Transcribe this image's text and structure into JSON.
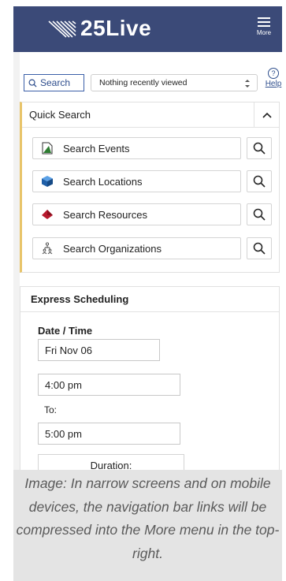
{
  "app": {
    "logo_text": "25Live",
    "more_label": "More"
  },
  "search_bar": {
    "search_label": "Search",
    "recent_value": "Nothing recently viewed",
    "help_label": "Help",
    "help_symbol": "?"
  },
  "quick_search": {
    "title": "Quick Search",
    "items": [
      {
        "label": "Search Events",
        "icon": "events-document-icon"
      },
      {
        "label": "Search Locations",
        "icon": "locations-cube-icon"
      },
      {
        "label": "Search Resources",
        "icon": "resources-diamond-icon"
      },
      {
        "label": "Search Organizations",
        "icon": "organizations-people-icon"
      }
    ]
  },
  "express": {
    "title": "Express Scheduling",
    "date_time_label": "Date / Time",
    "date_value": "Fri Nov 06",
    "start_time": "4:00 pm",
    "to_label": "To:",
    "end_time": "5:00 pm",
    "duration_label": "Duration:"
  },
  "caption": {
    "text": "Image: In narrow screens and on mobile devices, the navigation bar links will be compressed into the More menu in the top-right."
  },
  "colors": {
    "topbar": "#3b4a78",
    "accent_link": "#2d4d8c",
    "quick_search_border": "#e8c46a"
  }
}
